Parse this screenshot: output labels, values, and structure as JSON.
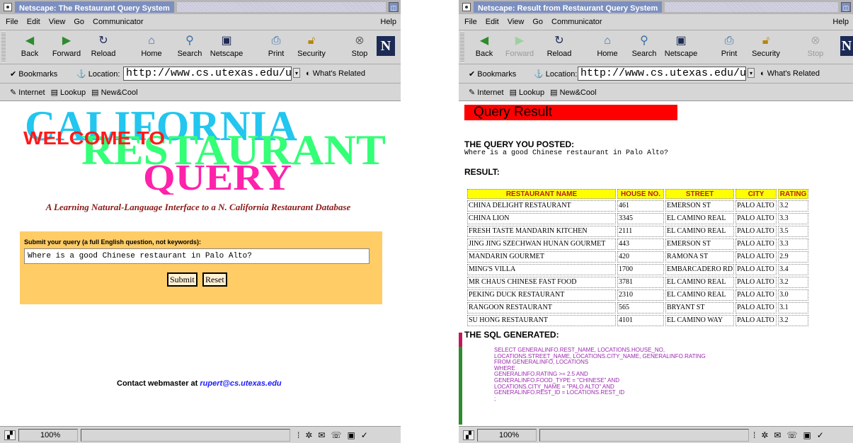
{
  "left_window": {
    "title": "Netscape: The Restaurant Query System",
    "menu": [
      "File",
      "Edit",
      "View",
      "Go",
      "Communicator"
    ],
    "menu_help": "Help",
    "toolbar": {
      "back": "Back",
      "forward": "Forward",
      "reload": "Reload",
      "home": "Home",
      "search": "Search",
      "netscape": "Netscape",
      "print": "Print",
      "security": "Security",
      "stop": "Stop"
    },
    "location": {
      "bookmarks": "Bookmarks",
      "label": "Location:",
      "url": "http://www.cs.utexas.edu/users/",
      "related": "What's Related"
    },
    "personal": [
      "Internet",
      "Lookup",
      "New&Cool"
    ],
    "page": {
      "logo_line1": "CALIFORNIA",
      "logo_welcome": "WELCOME TO",
      "logo_line2": "RESTAURANT",
      "logo_line3": "QUERY",
      "subtitle": "A Learning Natural-Language Interface to a N. California Restaurant Database",
      "form_label": "Submit your query (a full English question, not keywords):",
      "query_value": "Where is a good Chinese restaurant in Palo Alto?",
      "submit": "Submit",
      "reset": "Reset",
      "contact_text": "Contact webmaster at",
      "contact_email": "rupert@cs.utexas.edu"
    },
    "status": {
      "zoom": "100%"
    }
  },
  "right_window": {
    "title": "Netscape: Result from Restaurant Query System",
    "menu": [
      "File",
      "Edit",
      "View",
      "Go",
      "Communicator"
    ],
    "menu_help": "Help",
    "toolbar": {
      "back": "Back",
      "forward": "Forward",
      "reload": "Reload",
      "home": "Home",
      "search": "Search",
      "netscape": "Netscape",
      "print": "Print",
      "security": "Security",
      "stop": "Stop"
    },
    "location": {
      "bookmarks": "Bookmarks",
      "label": "Location:",
      "url": "http://www.cs.utexas.edu/users/",
      "related": "What's Related"
    },
    "personal": [
      "Internet",
      "Lookup",
      "New&Cool"
    ],
    "page": {
      "heading": "Query Result",
      "posted_label": "THE QUERY YOU POSTED:",
      "posted_query": "Where is a good Chinese restaurant in Palo Alto?",
      "result_label": "RESULT:",
      "columns": [
        "RESTAURANT NAME",
        "HOUSE NO.",
        "STREET",
        "CITY",
        "RATING"
      ],
      "rows": [
        [
          "CHINA DELIGHT RESTAURANT",
          "461",
          "EMERSON ST",
          "PALO ALTO",
          "3.2"
        ],
        [
          "CHINA LION",
          "3345",
          "EL CAMINO REAL",
          "PALO ALTO",
          "3.3"
        ],
        [
          "FRESH TASTE MANDARIN KITCHEN",
          "2111",
          "EL CAMINO REAL",
          "PALO ALTO",
          "3.5"
        ],
        [
          "JING JING SZECHWAN HUNAN GOURMET",
          "443",
          "EMERSON ST",
          "PALO ALTO",
          "3.3"
        ],
        [
          "MANDARIN GOURMET",
          "420",
          "RAMONA ST",
          "PALO ALTO",
          "2.9"
        ],
        [
          "MING'S VILLA",
          "1700",
          "EMBARCADERO RD",
          "PALO ALTO",
          "3.4"
        ],
        [
          "MR CHAUS CHINESE FAST FOOD",
          "3781",
          "EL CAMINO REAL",
          "PALO ALTO",
          "3.2"
        ],
        [
          "PEKING DUCK RESTAURANT",
          "2310",
          "EL CAMINO REAL",
          "PALO ALTO",
          "3.0"
        ],
        [
          "RANGOON RESTAURANT",
          "565",
          "BRYANT ST",
          "PALO ALTO",
          "3.1"
        ],
        [
          "SU HONG RESTAURANT",
          "4101",
          "EL CAMINO WAY",
          "PALO ALTO",
          "3.2"
        ]
      ],
      "sql_label": "THE SQL GENERATED:",
      "sql": "SELECT GENERALINFO.REST_NAME, LOCATIONS.HOUSE_NO,\nLOCATIONS.STREET_NAME, LOCATIONS.CITY_NAME, GENERALINFO.RATING\nFROM GENERALINFO, LOCATIONS\nWHERE\nGENERALINFO.RATING >= 2.5 AND\nGENERALINFO.FOOD_TYPE = \"CHINESE\" AND\nLOCATIONS.CITY_NAME = \"PALO ALTO\" AND\nGENERALINFO.REST_ID = LOCATIONS.REST_ID\n;"
    },
    "status": {
      "zoom": "100%"
    }
  }
}
